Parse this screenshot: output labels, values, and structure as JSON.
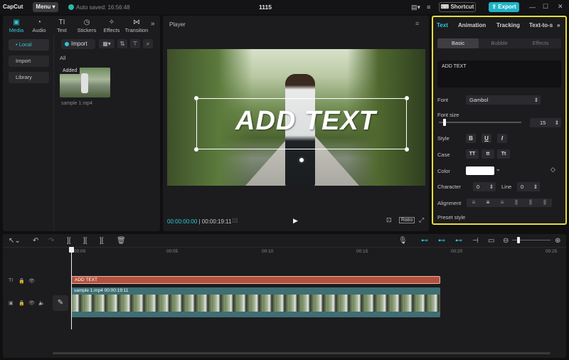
{
  "app": {
    "logo": "CapCut",
    "menu": "Menu",
    "autosave": "Auto saved: 16:56:48",
    "project_title": "1115",
    "shortcut": "Shortcut",
    "export": "Export"
  },
  "media_toolbar": [
    {
      "label": "Media",
      "icon": "media-icon"
    },
    {
      "label": "Audio",
      "icon": "audio-icon"
    },
    {
      "label": "Text",
      "icon": "text-icon"
    },
    {
      "label": "Stickers",
      "icon": "sticker-icon"
    },
    {
      "label": "Effects",
      "icon": "effects-icon"
    },
    {
      "label": "Transition",
      "icon": "transition-icon"
    }
  ],
  "media_sidebar": [
    "• Local",
    "Import",
    "Library"
  ],
  "media": {
    "import": "Import",
    "filter_all": "All",
    "thumb_badge": "Added",
    "file_name": "sample 1.mp4"
  },
  "player": {
    "title": "Player",
    "overlay_text": "ADD TEXT",
    "current_time": "00:00:00:00",
    "total_time": "00:00:19:11",
    "ratio": "Ratio"
  },
  "props": {
    "tabs": [
      "Text",
      "Animation",
      "Tracking",
      "Text-to-s"
    ],
    "subtabs": [
      "Basic",
      "Bubble",
      "Effects"
    ],
    "text_value": "ADD TEXT",
    "font_label": "Font",
    "font_value": "Gambol",
    "size_label": "Font size",
    "size_value": "15",
    "size_fraction": 0.05,
    "style_label": "Style",
    "style_buttons": [
      "B",
      "U",
      "I"
    ],
    "case_label": "Case",
    "case_buttons": [
      "TT",
      "tt",
      "Tt"
    ],
    "color_label": "Color",
    "color_value": "#ffffff",
    "character_label": "Character",
    "character_value": "0",
    "line_label": "Line",
    "line_value": "0",
    "alignment_label": "Alignment",
    "preset_label": "Preset style"
  },
  "timeline": {
    "ruler": [
      "00:00",
      "00:05",
      "00:10",
      "00:15",
      "00:20",
      "00:25"
    ],
    "text_clip": "ADD TEXT",
    "video_clip": "sample 1.mp4   00:00:19:11"
  },
  "colors": {
    "accent": "#2fc6d6",
    "highlight_border": "#e7dd3b",
    "text_clip": "#b4503d",
    "video_clip": "#3f6e73"
  }
}
